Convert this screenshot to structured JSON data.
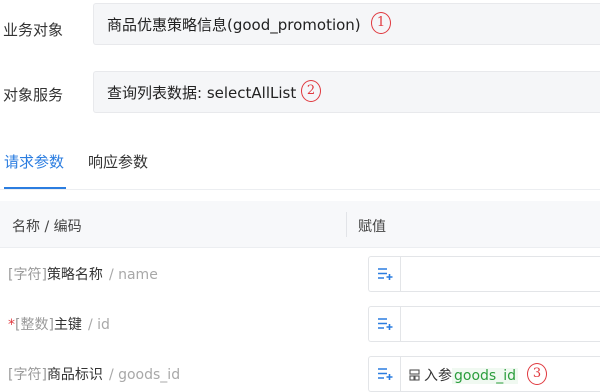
{
  "business_object": {
    "label": "业务对象",
    "value": "商品优惠策略信息(good_promotion)",
    "marker": "1"
  },
  "object_service": {
    "label": "对象服务",
    "value": "查询列表数据: selectAllList",
    "marker": "2"
  },
  "tabs": [
    {
      "label": "请求参数",
      "active": true
    },
    {
      "label": "响应参数",
      "active": false
    }
  ],
  "table": {
    "columns": [
      "名称 / 编码",
      "赋值"
    ],
    "rows": [
      {
        "required": "",
        "type": "[字符]",
        "name": "策略名称",
        "code": "/ name",
        "value_prefix": "",
        "value_name": "",
        "marker": ""
      },
      {
        "required": "*",
        "type": "[整数]",
        "name": "主键",
        "code": "/ id",
        "value_prefix": "",
        "value_name": "",
        "marker": ""
      },
      {
        "required": "",
        "type": "[字符]",
        "name": "商品标识",
        "code": "/ goods_id",
        "value_prefix": "入参",
        "value_name": "goods_id",
        "marker": "3"
      }
    ]
  },
  "colors": {
    "accent": "#2b7de0",
    "marker": "#e0383e",
    "param_name": "#2a9d3c"
  },
  "icons": {
    "assign_button": "assign-expression-icon",
    "param_chip": "input-param-icon"
  }
}
